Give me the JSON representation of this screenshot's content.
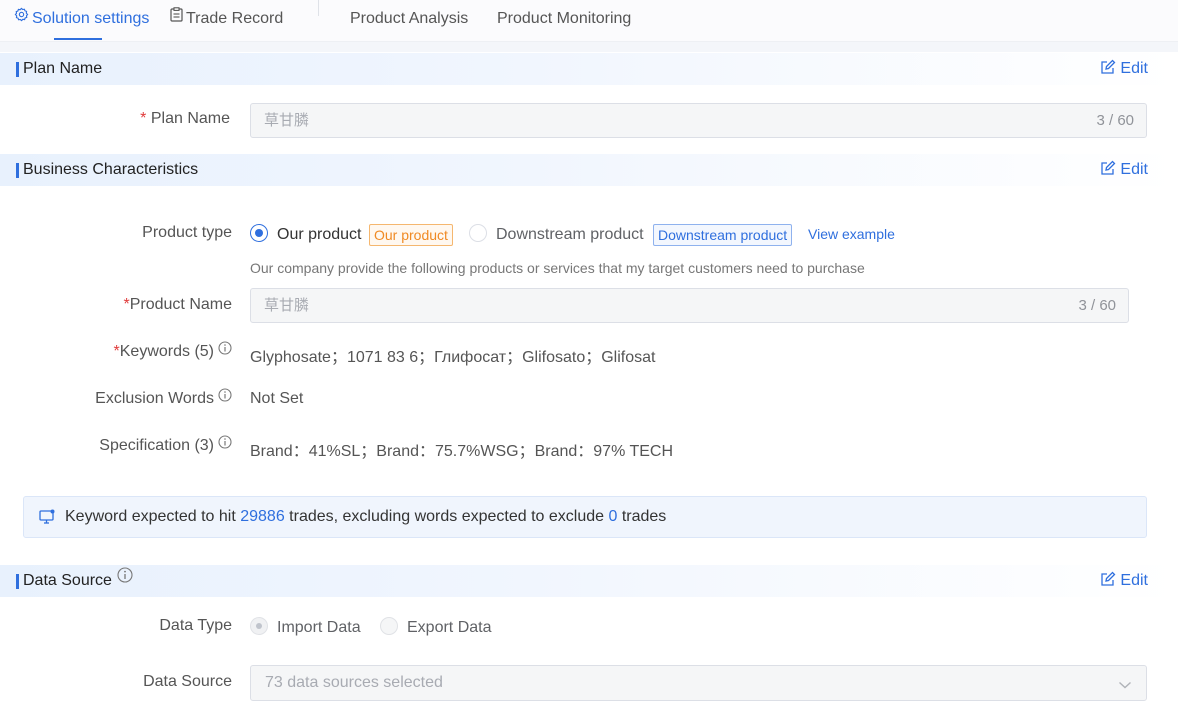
{
  "tabs": [
    {
      "label": "Solution settings",
      "icon": "gear-icon",
      "active": true
    },
    {
      "label": "Trade Record",
      "icon": "clipboard-icon",
      "active": false
    },
    {
      "label": "Product Analysis",
      "active": false
    },
    {
      "label": "Product Monitoring",
      "active": false
    }
  ],
  "edit_label": "Edit",
  "plan_section": {
    "title": "Plan Name",
    "field_label": "Plan Name",
    "required_mark": "*",
    "value": "草甘膦",
    "count": "3 / 60"
  },
  "business_section": {
    "title": "Business Characteristics",
    "product_type_label": "Product type",
    "option_our": "Our product",
    "tag_our": "Our product",
    "option_downstream": "Downstream product",
    "tag_downstream": "Downstream product",
    "view_example": "View example",
    "hint": "Our company provide the following products or services that my target customers need to purchase",
    "product_name_label": "Product Name",
    "product_name_value": "草甘膦",
    "product_name_count": "3 / 60",
    "keywords_label": "Keywords (5)",
    "keywords_value": "Glyphosate；1071 83 6；Глифосат；Glifosato；Glifosat",
    "exclusion_label": "Exclusion Words",
    "exclusion_value": "Not Set",
    "spec_label": "Specification (3)",
    "spec_value": "Brand：41%SL；Brand：75.7%WSG；Brand：97% TECH"
  },
  "notice": {
    "prefix": "Keyword expected to hit ",
    "hit_count": "29886",
    "middle": " trades, excluding words expected to exclude ",
    "exclude_count": "0",
    "suffix": " trades"
  },
  "data_section": {
    "title": "Data Source",
    "data_type_label": "Data Type",
    "option_import": "Import Data",
    "option_export": "Export Data",
    "data_source_label": "Data Source",
    "data_source_value": "73 data sources selected"
  },
  "colors": {
    "accent": "#2f6fde",
    "required": "#e03a3a",
    "tag_orange": "#f08a24"
  }
}
